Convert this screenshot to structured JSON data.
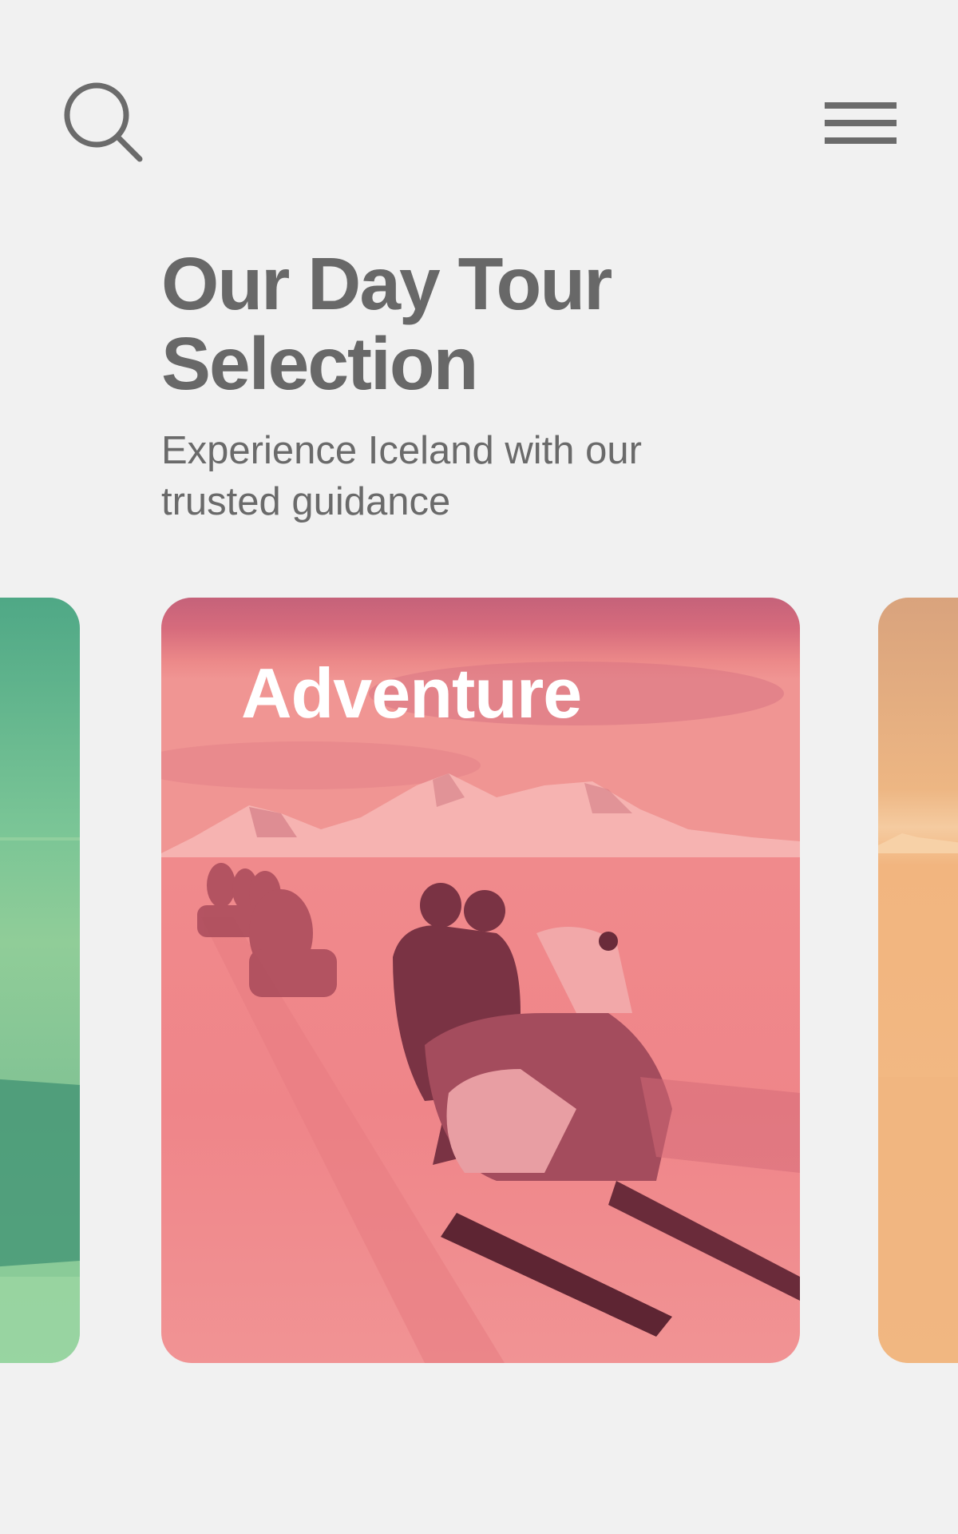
{
  "header": {
    "search_icon": "search-icon",
    "menu_icon": "hamburger-menu-icon"
  },
  "hero": {
    "title": "Our Day Tour Selection",
    "subtitle": "Experience Iceland with our trusted guidance"
  },
  "carousel": {
    "cards": [
      {
        "label": "",
        "tint_color": "#5fb891",
        "theme": "green"
      },
      {
        "label": "Adventure",
        "tint_color": "#e96b78",
        "theme": "pink"
      },
      {
        "label": "",
        "tint_color": "#f2b27a",
        "theme": "orange"
      }
    ]
  },
  "colors": {
    "background": "#f1f1f1",
    "text": "#686868",
    "card_label": "#ffffff"
  }
}
